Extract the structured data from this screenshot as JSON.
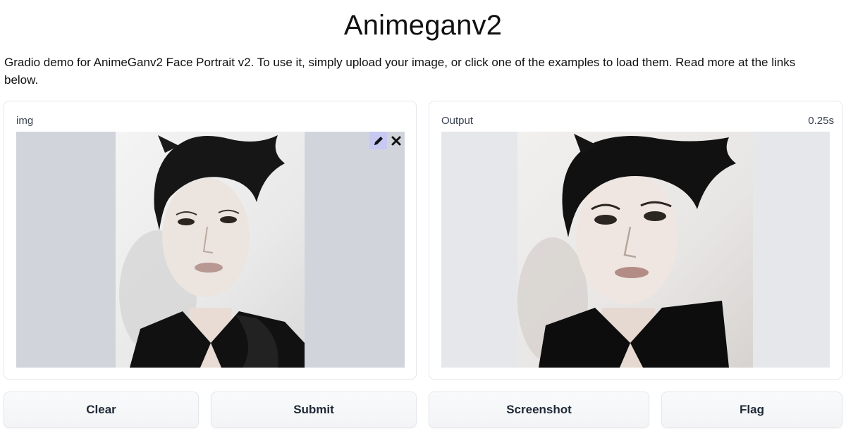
{
  "header": {
    "title": "Animeganv2",
    "description": "Gradio demo for AnimeGanv2 Face Portrait v2. To use it, simply upload your image, or click one of the examples to load them. Read more at the links below."
  },
  "input_panel": {
    "label": "img",
    "tools": {
      "edit_icon": "pencil-icon",
      "clear_icon": "close-icon"
    }
  },
  "output_panel": {
    "label": "Output",
    "timer": "0.25s"
  },
  "buttons": {
    "clear": "Clear",
    "submit": "Submit",
    "screenshot": "Screenshot",
    "flag": "Flag"
  },
  "colors": {
    "edit_tool_bg": "#c7c9f3",
    "input_bg": "#d1d5db",
    "output_bg": "#e5e7eb"
  }
}
